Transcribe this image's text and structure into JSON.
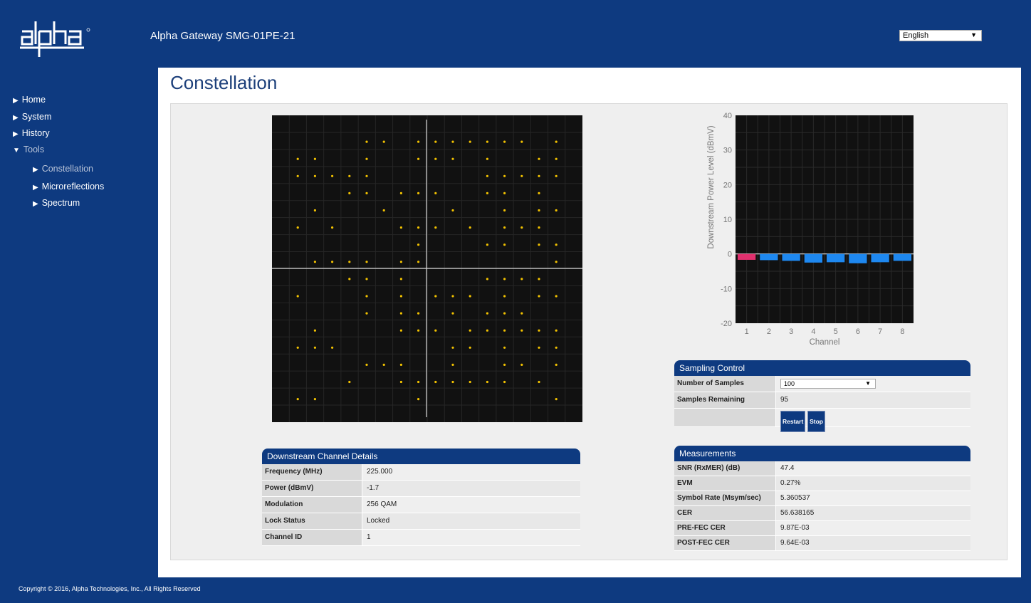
{
  "header": {
    "logo_text": "alpha",
    "title": "Alpha Gateway SMG-01PE-21",
    "language": "English"
  },
  "sidebar": {
    "items": [
      {
        "label": "Home"
      },
      {
        "label": "System"
      },
      {
        "label": "History"
      },
      {
        "label": "Tools"
      }
    ],
    "tools_items": [
      {
        "label": "Constellation"
      },
      {
        "label": "Microreflections"
      },
      {
        "label": "Spectrum"
      }
    ]
  },
  "page": {
    "title": "Constellation"
  },
  "constellation_points": [
    [
      5,
      1
    ],
    [
      6,
      1
    ],
    [
      8,
      1
    ],
    [
      9,
      1
    ],
    [
      10,
      1
    ],
    [
      11,
      1
    ],
    [
      12,
      1
    ],
    [
      13,
      1
    ],
    [
      14,
      1
    ],
    [
      16,
      1
    ],
    [
      1,
      2
    ],
    [
      2,
      2
    ],
    [
      5,
      2
    ],
    [
      8,
      2
    ],
    [
      9,
      2
    ],
    [
      10,
      2
    ],
    [
      12,
      2
    ],
    [
      15,
      2
    ],
    [
      16,
      2
    ],
    [
      1,
      3
    ],
    [
      2,
      3
    ],
    [
      3,
      3
    ],
    [
      4,
      3
    ],
    [
      5,
      3
    ],
    [
      12,
      3
    ],
    [
      13,
      3
    ],
    [
      14,
      3
    ],
    [
      15,
      3
    ],
    [
      16,
      3
    ],
    [
      4,
      4
    ],
    [
      5,
      4
    ],
    [
      7,
      4
    ],
    [
      8,
      4
    ],
    [
      9,
      4
    ],
    [
      12,
      4
    ],
    [
      13,
      4
    ],
    [
      15,
      4
    ],
    [
      2,
      5
    ],
    [
      6,
      5
    ],
    [
      10,
      5
    ],
    [
      13,
      5
    ],
    [
      15,
      5
    ],
    [
      16,
      5
    ],
    [
      1,
      6
    ],
    [
      3,
      6
    ],
    [
      7,
      6
    ],
    [
      8,
      6
    ],
    [
      9,
      6
    ],
    [
      11,
      6
    ],
    [
      13,
      6
    ],
    [
      14,
      6
    ],
    [
      15,
      6
    ],
    [
      8,
      7
    ],
    [
      12,
      7
    ],
    [
      13,
      7
    ],
    [
      15,
      7
    ],
    [
      16,
      7
    ],
    [
      2,
      8
    ],
    [
      3,
      8
    ],
    [
      4,
      8
    ],
    [
      5,
      8
    ],
    [
      7,
      8
    ],
    [
      8,
      8
    ],
    [
      16,
      8
    ],
    [
      4,
      9
    ],
    [
      5,
      9
    ],
    [
      7,
      9
    ],
    [
      12,
      9
    ],
    [
      13,
      9
    ],
    [
      14,
      9
    ],
    [
      15,
      9
    ],
    [
      1,
      10
    ],
    [
      5,
      10
    ],
    [
      7,
      10
    ],
    [
      9,
      10
    ],
    [
      10,
      10
    ],
    [
      11,
      10
    ],
    [
      13,
      10
    ],
    [
      15,
      10
    ],
    [
      16,
      10
    ],
    [
      5,
      11
    ],
    [
      7,
      11
    ],
    [
      8,
      11
    ],
    [
      10,
      11
    ],
    [
      12,
      11
    ],
    [
      13,
      11
    ],
    [
      14,
      11
    ],
    [
      2,
      12
    ],
    [
      7,
      12
    ],
    [
      8,
      12
    ],
    [
      9,
      12
    ],
    [
      11,
      12
    ],
    [
      12,
      12
    ],
    [
      13,
      12
    ],
    [
      14,
      12
    ],
    [
      15,
      12
    ],
    [
      16,
      12
    ],
    [
      1,
      13
    ],
    [
      2,
      13
    ],
    [
      3,
      13
    ],
    [
      10,
      13
    ],
    [
      11,
      13
    ],
    [
      13,
      13
    ],
    [
      15,
      13
    ],
    [
      16,
      13
    ],
    [
      5,
      14
    ],
    [
      6,
      14
    ],
    [
      7,
      14
    ],
    [
      10,
      14
    ],
    [
      13,
      14
    ],
    [
      14,
      14
    ],
    [
      16,
      14
    ],
    [
      4,
      15
    ],
    [
      7,
      15
    ],
    [
      8,
      15
    ],
    [
      9,
      15
    ],
    [
      10,
      15
    ],
    [
      11,
      15
    ],
    [
      12,
      15
    ],
    [
      13,
      15
    ],
    [
      15,
      15
    ],
    [
      1,
      16
    ],
    [
      2,
      16
    ],
    [
      8,
      16
    ],
    [
      16,
      16
    ]
  ],
  "chart_data": {
    "type": "bar",
    "categories": [
      "1",
      "2",
      "3",
      "4",
      "5",
      "6",
      "7",
      "8"
    ],
    "values": [
      -1.7,
      -1.8,
      -2.0,
      -2.5,
      -2.4,
      -2.7,
      -2.4,
      -2.0
    ],
    "ylabel": "Downstream Power Level (dBmV)",
    "xlabel": "Channel",
    "ylim": [
      -20,
      40
    ],
    "yticks": [
      40,
      30,
      20,
      10,
      0,
      -10,
      -20
    ],
    "grid": true,
    "colors": {
      "selected": "#e0306e",
      "default": "#1e88f0",
      "background": "#111111",
      "grid": "#2a2a2a"
    }
  },
  "downstream_details": {
    "title": "Downstream Channel Details",
    "rows": [
      {
        "label": "Frequency (MHz)",
        "value": "225.000"
      },
      {
        "label": "Power (dBmV)",
        "value": "-1.7"
      },
      {
        "label": "Modulation",
        "value": "256 QAM"
      },
      {
        "label": "Lock Status",
        "value": "Locked"
      },
      {
        "label": "Channel ID",
        "value": "1"
      }
    ]
  },
  "sampling_control": {
    "title": "Sampling Control",
    "number_of_samples_label": "Number of Samples",
    "number_of_samples_value": "100",
    "samples_remaining_label": "Samples Remaining",
    "samples_remaining_value": "95",
    "restart_label": "Restart",
    "stop_label": "Stop"
  },
  "measurements": {
    "title": "Measurements",
    "rows": [
      {
        "label": "SNR (RxMER) (dB)",
        "value": "47.4"
      },
      {
        "label": "EVM",
        "value": "0.27%"
      },
      {
        "label": "Symbol Rate (Msym/sec)",
        "value": "5.360537"
      },
      {
        "label": "CER",
        "value": "56.638165"
      },
      {
        "label": "PRE-FEC CER",
        "value": "9.87E-03"
      },
      {
        "label": "POST-FEC CER",
        "value": "9.64E-03"
      }
    ]
  },
  "footer": {
    "copyright": "Copyright © 2016, Alpha Technologies, Inc., All Rights Reserved"
  }
}
